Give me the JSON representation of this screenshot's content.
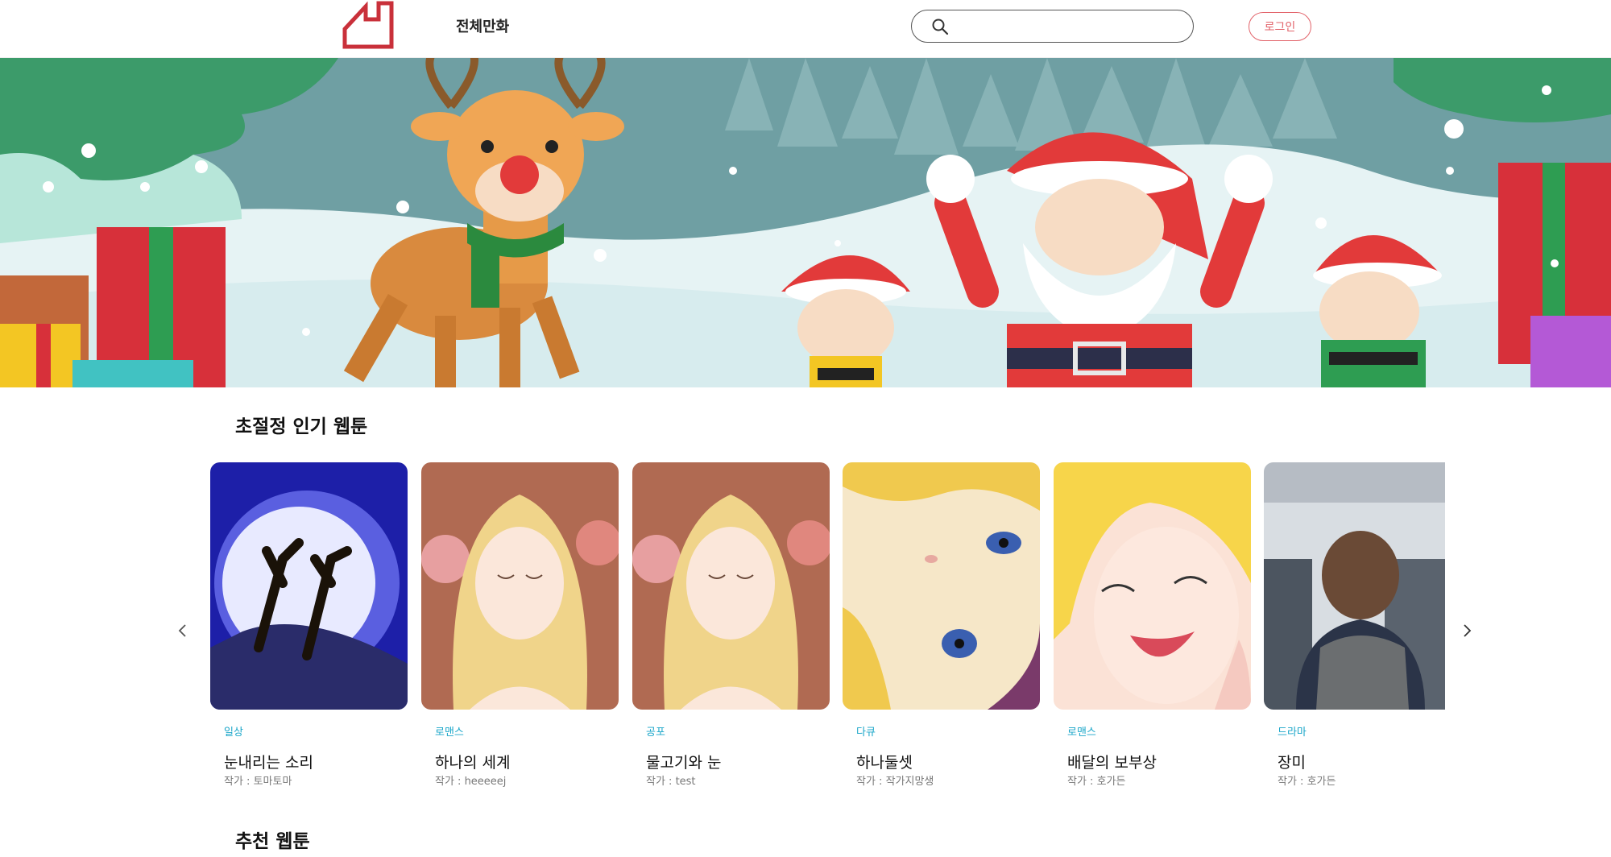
{
  "header": {
    "nav_all": "전체만화",
    "search_placeholder": "",
    "login_label": "로그인"
  },
  "sections": {
    "popular_title": "초절정 인기 웹툰",
    "recommended_title": "추천 웹툰"
  },
  "cards": [
    {
      "genre": "일상",
      "title": "눈내리는 소리",
      "author": "작가 : 토마토마"
    },
    {
      "genre": "로맨스",
      "title": "하나의 세계",
      "author": "작가 : heeeeej"
    },
    {
      "genre": "공포",
      "title": "물고기와 눈",
      "author": "작가 : test"
    },
    {
      "genre": "다큐",
      "title": "하나둘셋",
      "author": "작가 : 작가지망생"
    },
    {
      "genre": "로맨스",
      "title": "배달의 보부상",
      "author": "작가 : 호가든"
    },
    {
      "genre": "드라마",
      "title": "장미",
      "author": "작가 : 호가든"
    }
  ],
  "colors": {
    "brand_red": "#c9303a",
    "login_accent": "#e2636a",
    "genre_blue": "#1aa6c9"
  }
}
